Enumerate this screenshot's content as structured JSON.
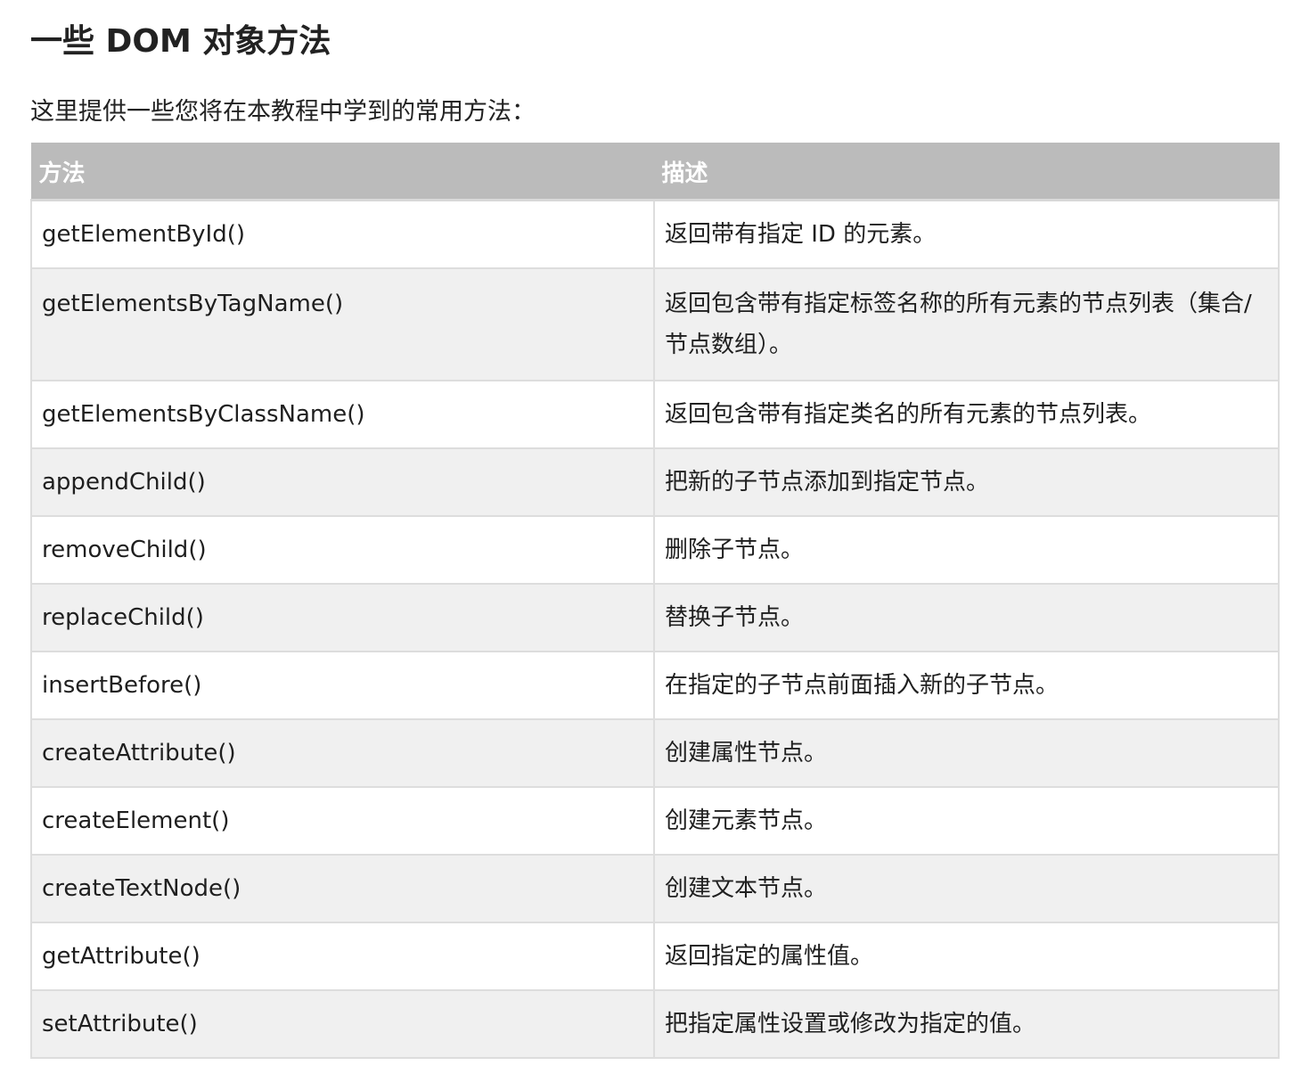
{
  "section": {
    "title": "一些 DOM 对象方法",
    "intro": "这里提供一些您将在本教程中学到的常用方法："
  },
  "table": {
    "headers": [
      "方法",
      "描述"
    ],
    "rows": [
      {
        "method": "getElementById()",
        "description": "返回带有指定 ID 的元素。"
      },
      {
        "method": "getElementsByTagName()",
        "description": "返回包含带有指定标签名称的所有元素的节点列表（集合/节点数组）。"
      },
      {
        "method": "getElementsByClassName()",
        "description": "返回包含带有指定类名的所有元素的节点列表。"
      },
      {
        "method": "appendChild()",
        "description": "把新的子节点添加到指定节点。"
      },
      {
        "method": "removeChild()",
        "description": "删除子节点。"
      },
      {
        "method": "replaceChild()",
        "description": "替换子节点。"
      },
      {
        "method": "insertBefore()",
        "description": "在指定的子节点前面插入新的子节点。"
      },
      {
        "method": "createAttribute()",
        "description": "创建属性节点。"
      },
      {
        "method": "createElement()",
        "description": "创建元素节点。"
      },
      {
        "method": "createTextNode()",
        "description": "创建文本节点。"
      },
      {
        "method": "getAttribute()",
        "description": "返回指定的属性值。"
      },
      {
        "method": "setAttribute()",
        "description": "把指定属性设置或修改为指定的值。"
      }
    ]
  },
  "colors": {
    "header_bg": "#bbbbbb",
    "header_text": "#ffffff",
    "row_alt_bg": "#f0f0f0",
    "border": "#dddddd"
  }
}
